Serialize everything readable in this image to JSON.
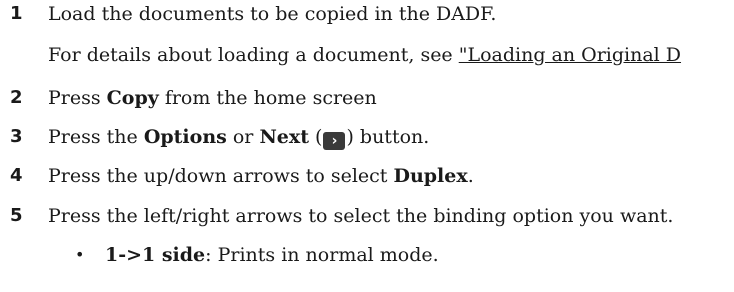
{
  "steps": [
    {
      "number": "1",
      "text": "Load the documents to be copied in the DADF.",
      "detail_prefix": "For details about loading a document, see ",
      "detail_link": "\"Loading an Original D"
    },
    {
      "number": "2",
      "prefix": "Press ",
      "bold": "Copy",
      "suffix": " from the home screen"
    },
    {
      "number": "3",
      "prefix": "Press the ",
      "bold1": "Options",
      "middle": " or ",
      "bold2": "Next",
      "paren_open": " (",
      "paren_close": ") button."
    },
    {
      "number": "4",
      "prefix": "Press the up/down arrows to select ",
      "bold": "Duplex",
      "suffix": "."
    },
    {
      "number": "5",
      "text": "Press the left/right arrows to select the binding option you want."
    }
  ],
  "bullets": [
    {
      "marker": "•",
      "bold": "1->1 side",
      "suffix": ": Prints in normal mode."
    }
  ],
  "icons": {
    "next_button_glyph": "›",
    "next_button_color": "#3a3a3a"
  }
}
